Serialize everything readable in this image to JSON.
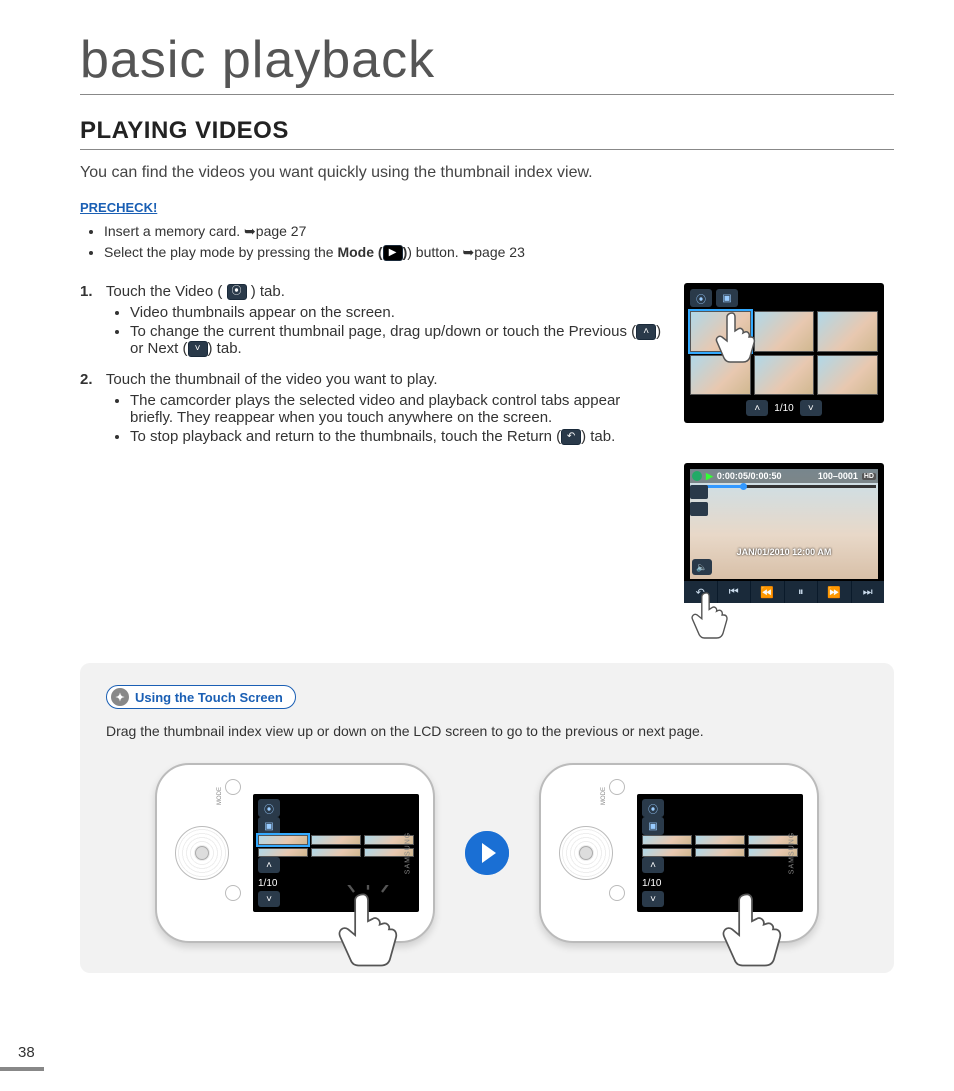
{
  "page_number": "38",
  "chapter_title": "basic playback",
  "section_title": "PLAYING VIDEOS",
  "intro": "You can find the videos you want quickly using the thumbnail index view.",
  "precheck": {
    "label": "PRECHECK!",
    "items": [
      {
        "text_a": "Insert a memory card. ",
        "ref": "➥page 27"
      },
      {
        "text_a": "Select the play mode by pressing the ",
        "bold": "Mode (",
        "text_b": ") button. ",
        "ref": "➥page 23"
      }
    ]
  },
  "steps": [
    {
      "num": "1.",
      "lead_a": "Touch the Video ( ",
      "lead_b": " ) tab.",
      "subs": [
        "Video thumbnails appear on the screen.",
        "To change the current thumbnail page, drag up/down or touch the Previous ( ^ ) or Next ( v ) tab."
      ]
    },
    {
      "num": "2.",
      "lead_a": "Touch the thumbnail of the video you want to play.",
      "lead_b": "",
      "subs": [
        "The camcorder plays the selected video and playback control tabs appear briefly. They reappear when you touch anywhere on the screen.",
        "To stop playback and return to the thumbnails, touch the Return ( ↩ ) tab."
      ]
    }
  ],
  "thumb_screen": {
    "page_indicator": "1/10"
  },
  "play_screen": {
    "time": "0:00:05/0:00:50",
    "clip": "100–0001",
    "date": "JAN/01/2010  12:00 AM"
  },
  "tip": {
    "title": "Using the Touch Screen",
    "text": "Drag the thumbnail index view up or down on the LCD screen to go to the previous or next page.",
    "device_page_indicator": "1/10",
    "brand": "SAMSUNG",
    "btn_top_label": "MODE",
    "btn_bot_label": ""
  }
}
